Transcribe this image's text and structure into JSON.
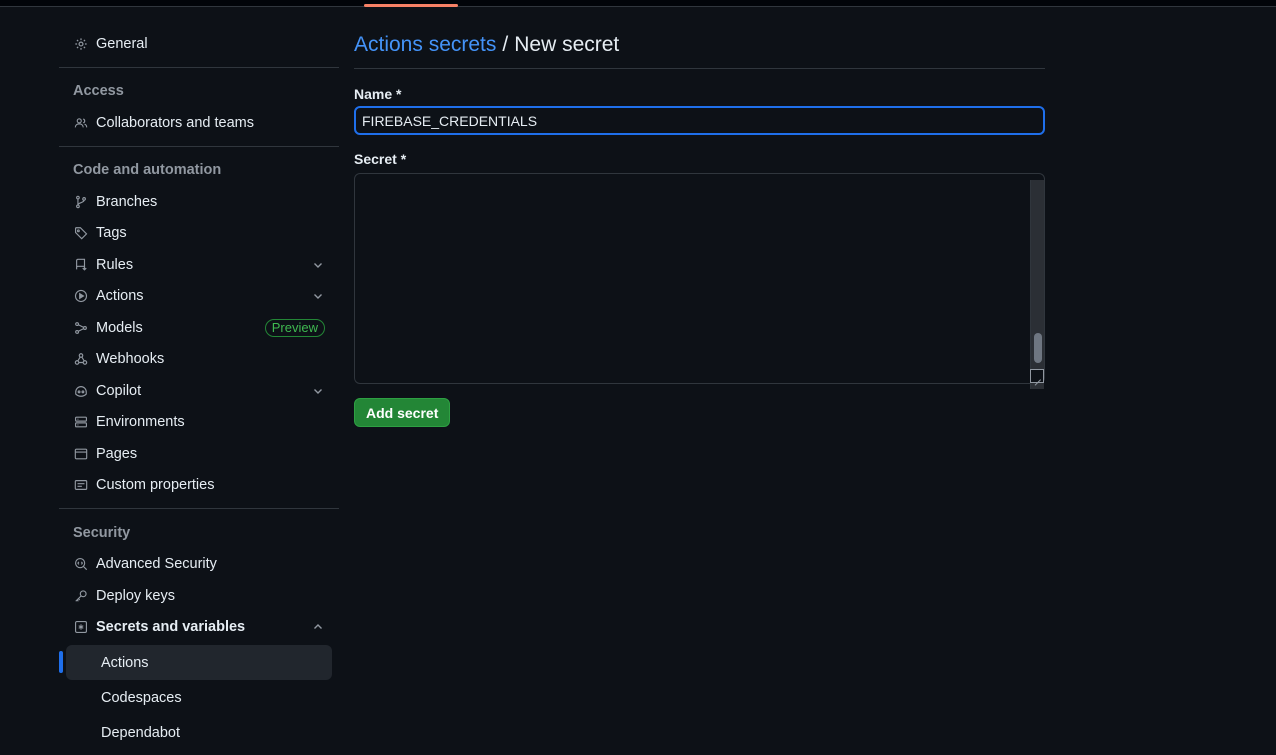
{
  "sidebar": {
    "general": "General",
    "access_heading": "Access",
    "collaborators": "Collaborators and teams",
    "code_heading": "Code and automation",
    "branches": "Branches",
    "tags": "Tags",
    "rules": "Rules",
    "actions": "Actions",
    "models": "Models",
    "models_badge": "Preview",
    "webhooks": "Webhooks",
    "copilot": "Copilot",
    "environments": "Environments",
    "pages": "Pages",
    "custom_properties": "Custom properties",
    "security_heading": "Security",
    "advanced_security": "Advanced Security",
    "deploy_keys": "Deploy keys",
    "secrets_and_variables": "Secrets and variables",
    "sub_items": [
      "Actions",
      "Codespaces",
      "Dependabot"
    ]
  },
  "main": {
    "breadcrumb_link": "Actions secrets",
    "breadcrumb_sep": "/",
    "breadcrumb_current": "New secret",
    "name_label": "Name *",
    "name_value": "FIREBASE_CREDENTIALS",
    "secret_label": "Secret *",
    "secret_value": "",
    "add_button": "Add secret"
  },
  "colors": {
    "background": "#0d1117",
    "link": "#4493f8",
    "primary_button": "#238636",
    "focus_border": "#1f6feb",
    "badge_green": "#3fb950"
  }
}
